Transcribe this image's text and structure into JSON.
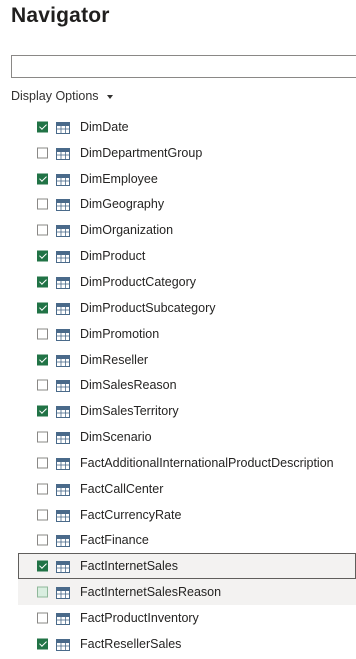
{
  "header": {
    "title": "Navigator"
  },
  "search": {
    "value": "",
    "placeholder": ""
  },
  "display_options": {
    "label": "Display Options"
  },
  "items": [
    {
      "label": "DimDate",
      "checked": true
    },
    {
      "label": "DimDepartmentGroup",
      "checked": false
    },
    {
      "label": "DimEmployee",
      "checked": true
    },
    {
      "label": "DimGeography",
      "checked": false
    },
    {
      "label": "DimOrganization",
      "checked": false
    },
    {
      "label": "DimProduct",
      "checked": true
    },
    {
      "label": "DimProductCategory",
      "checked": true
    },
    {
      "label": "DimProductSubcategory",
      "checked": true
    },
    {
      "label": "DimPromotion",
      "checked": false
    },
    {
      "label": "DimReseller",
      "checked": true
    },
    {
      "label": "DimSalesReason",
      "checked": false
    },
    {
      "label": "DimSalesTerritory",
      "checked": true
    },
    {
      "label": "DimScenario",
      "checked": false
    },
    {
      "label": "FactAdditionalInternationalProductDescription",
      "checked": false
    },
    {
      "label": "FactCallCenter",
      "checked": false
    },
    {
      "label": "FactCurrencyRate",
      "checked": false
    },
    {
      "label": "FactFinance",
      "checked": false
    },
    {
      "label": "FactInternetSales",
      "checked": true,
      "state": "selected"
    },
    {
      "label": "FactInternetSalesReason",
      "checked": false,
      "state": "hover"
    },
    {
      "label": "FactProductInventory",
      "checked": false
    },
    {
      "label": "FactResellerSales",
      "checked": true
    }
  ],
  "colors": {
    "check_fill": "#217346",
    "table_icon": "#4a6a8a",
    "text": "#252423"
  },
  "icons": {
    "table": "table-icon",
    "dropdown": "chevron-down-icon"
  }
}
